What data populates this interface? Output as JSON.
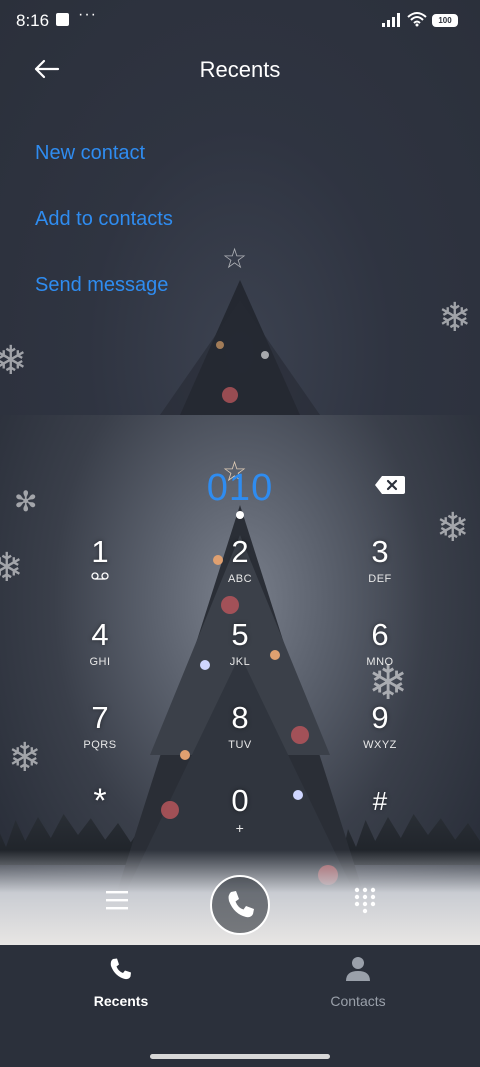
{
  "status_bar": {
    "time": "8:16",
    "dots": "···",
    "battery": "100"
  },
  "header": {
    "title": "Recents",
    "back_icon": "arrow-left-icon"
  },
  "actions": [
    {
      "label": "New contact"
    },
    {
      "label": "Add to contacts"
    },
    {
      "label": "Send message"
    }
  ],
  "dialer": {
    "number": "010",
    "backspace_icon": "backspace-icon",
    "keys": [
      {
        "digit": "1",
        "letters": ""
      },
      {
        "digit": "2",
        "letters": "ABC"
      },
      {
        "digit": "3",
        "letters": "DEF"
      },
      {
        "digit": "4",
        "letters": "GHI"
      },
      {
        "digit": "5",
        "letters": "JKL"
      },
      {
        "digit": "6",
        "letters": "MNO"
      },
      {
        "digit": "7",
        "letters": "PQRS"
      },
      {
        "digit": "8",
        "letters": "TUV"
      },
      {
        "digit": "9",
        "letters": "WXYZ"
      },
      {
        "digit": "*",
        "letters": ""
      },
      {
        "digit": "0",
        "letters": "+"
      },
      {
        "digit": "#",
        "letters": ""
      }
    ]
  },
  "bottom_nav": [
    {
      "label": "Recents",
      "icon": "phone-icon",
      "active": true
    },
    {
      "label": "Contacts",
      "icon": "person-icon",
      "active": false
    }
  ],
  "colors": {
    "accent": "#2f8cf0",
    "background": "#2b303b"
  }
}
